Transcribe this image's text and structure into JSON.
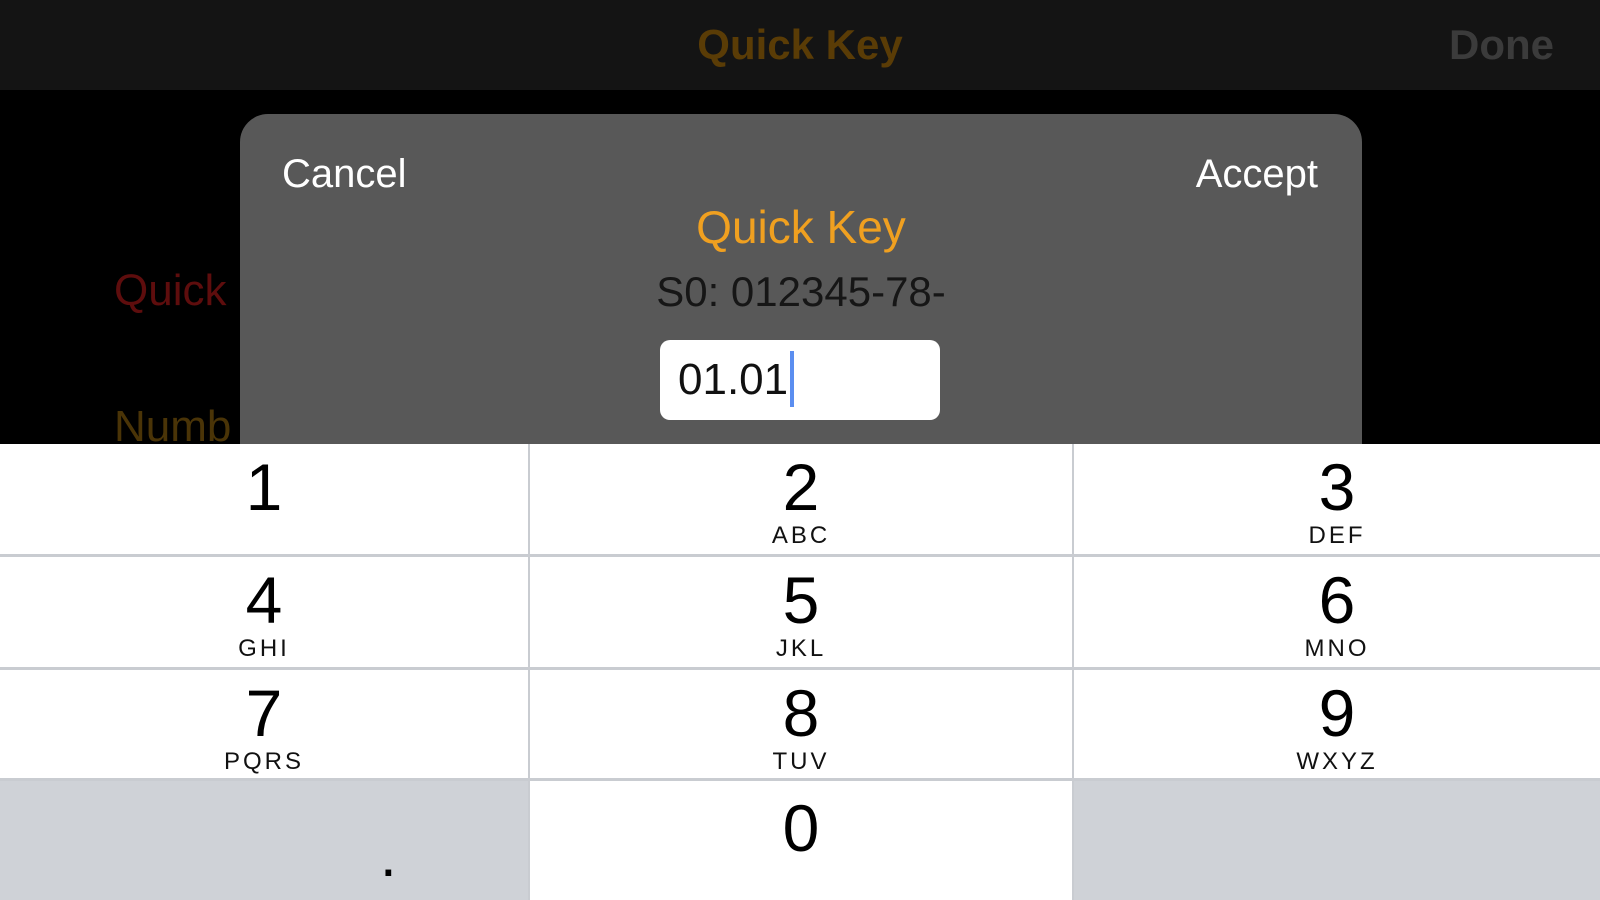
{
  "navbar": {
    "title": "Quick Key",
    "done_label": "Done"
  },
  "background": {
    "label1": "Quick",
    "label2": "Numb"
  },
  "dialog": {
    "cancel_label": "Cancel",
    "accept_label": "Accept",
    "title": "Quick Key",
    "prefix": "S0: 012345-78-",
    "input_value": "01.01"
  },
  "keypad": {
    "keys": [
      {
        "num": "1",
        "letters": ""
      },
      {
        "num": "2",
        "letters": "ABC"
      },
      {
        "num": "3",
        "letters": "DEF"
      },
      {
        "num": "4",
        "letters": "GHI"
      },
      {
        "num": "5",
        "letters": "JKL"
      },
      {
        "num": "6",
        "letters": "MNO"
      },
      {
        "num": "7",
        "letters": "PQRS"
      },
      {
        "num": "8",
        "letters": "TUV"
      },
      {
        "num": "9",
        "letters": "WXYZ"
      },
      {
        "num": "0",
        "letters": ""
      }
    ],
    "decimal_label": ".",
    "delete_icon": "backspace-icon"
  },
  "colors": {
    "accent": "#f0a020",
    "dialog_bg": "#585858",
    "key_bg": "#ffffff",
    "key_gray_bg": "#cfd2d7"
  }
}
